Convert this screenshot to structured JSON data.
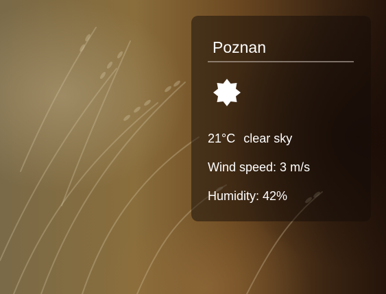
{
  "weather": {
    "city": "Poznan",
    "icon": "sun-icon",
    "temperature": "21°C",
    "description": "clear sky",
    "wind": "Wind speed: 3 m/s",
    "humidity": "Humidity: 42%"
  },
  "colors": {
    "card_background": "#140c08",
    "text": "#ffffff",
    "underline": "#c8beb4"
  },
  "background": {
    "icon": "wheat-field-photo"
  }
}
